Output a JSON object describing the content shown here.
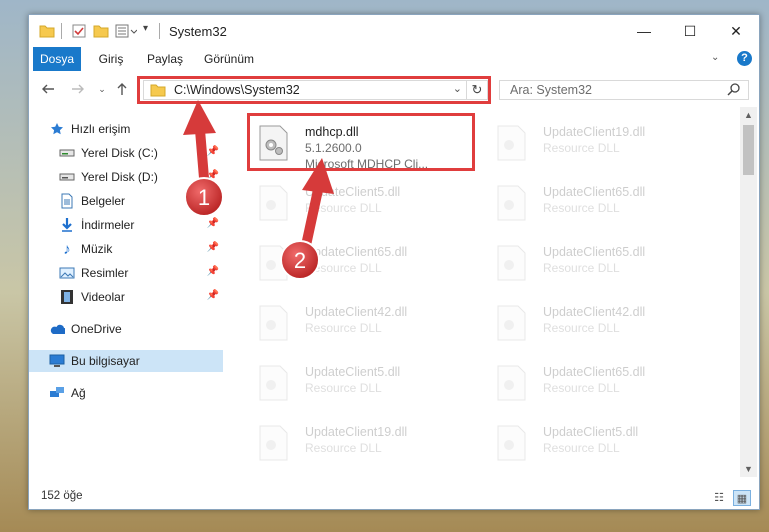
{
  "window": {
    "title": "System32",
    "controls": {
      "minimize": "—",
      "maximize": "☐",
      "close": "✕"
    }
  },
  "ribbon": {
    "tabs": [
      {
        "label": "Dosya",
        "active": true
      },
      {
        "label": "Giriş"
      },
      {
        "label": "Paylaş"
      },
      {
        "label": "Görünüm"
      }
    ],
    "help": "?"
  },
  "address": {
    "path": "C:\\Windows\\System32",
    "search_placeholder": "Ara: System32"
  },
  "sidebar": {
    "items": [
      {
        "label": "Hızlı erişim",
        "icon": "star-icon"
      },
      {
        "label": "Yerel Disk (C:)",
        "icon": "drive-icon",
        "pinned": true
      },
      {
        "label": "Yerel Disk (D:)",
        "icon": "drive-icon",
        "pinned": true
      },
      {
        "label": "Belgeler",
        "icon": "documents-icon",
        "pinned": true
      },
      {
        "label": "İndirmeler",
        "icon": "download-icon",
        "pinned": true
      },
      {
        "label": "Müzik",
        "icon": "music-icon",
        "pinned": true
      },
      {
        "label": "Resimler",
        "icon": "pictures-icon",
        "pinned": true
      },
      {
        "label": "Videolar",
        "icon": "video-icon",
        "pinned": true
      },
      {
        "label": "OneDrive",
        "icon": "cloud-icon"
      },
      {
        "label": "Bu bilgisayar",
        "icon": "computer-icon",
        "selected": true
      },
      {
        "label": "Ağ",
        "icon": "network-icon"
      }
    ]
  },
  "files": [
    {
      "name": "mdhcp.dll",
      "version": "5.1.2600.0",
      "desc": "Microsoft MDHCP Cli...",
      "highlight": true
    },
    {
      "name": "UpdateClient19.dll",
      "desc": "Resource DLL"
    },
    {
      "name": "UpdateClient5.dll",
      "desc": "Resource DLL"
    },
    {
      "name": "UpdateClient65.dll",
      "desc": "Resource DLL"
    },
    {
      "name": "UpdateClient65.dll",
      "desc": "Resource DLL"
    },
    {
      "name": "UpdateClient65.dll",
      "desc": "Resource DLL"
    },
    {
      "name": "UpdateClient42.dll",
      "desc": "Resource DLL"
    },
    {
      "name": "UpdateClient42.dll",
      "desc": "Resource DLL"
    },
    {
      "name": "UpdateClient5.dll",
      "desc": "Resource DLL"
    },
    {
      "name": "UpdateClient65.dll",
      "desc": "Resource DLL"
    },
    {
      "name": "UpdateClient19.dll",
      "desc": "Resource DLL"
    },
    {
      "name": "UpdateClient5.dll",
      "desc": "Resource DLL"
    }
  ],
  "status": {
    "count": "152 öğe"
  },
  "annotations": {
    "badge1": "1",
    "badge2": "2",
    "highlight_color": "#e03d3d"
  }
}
